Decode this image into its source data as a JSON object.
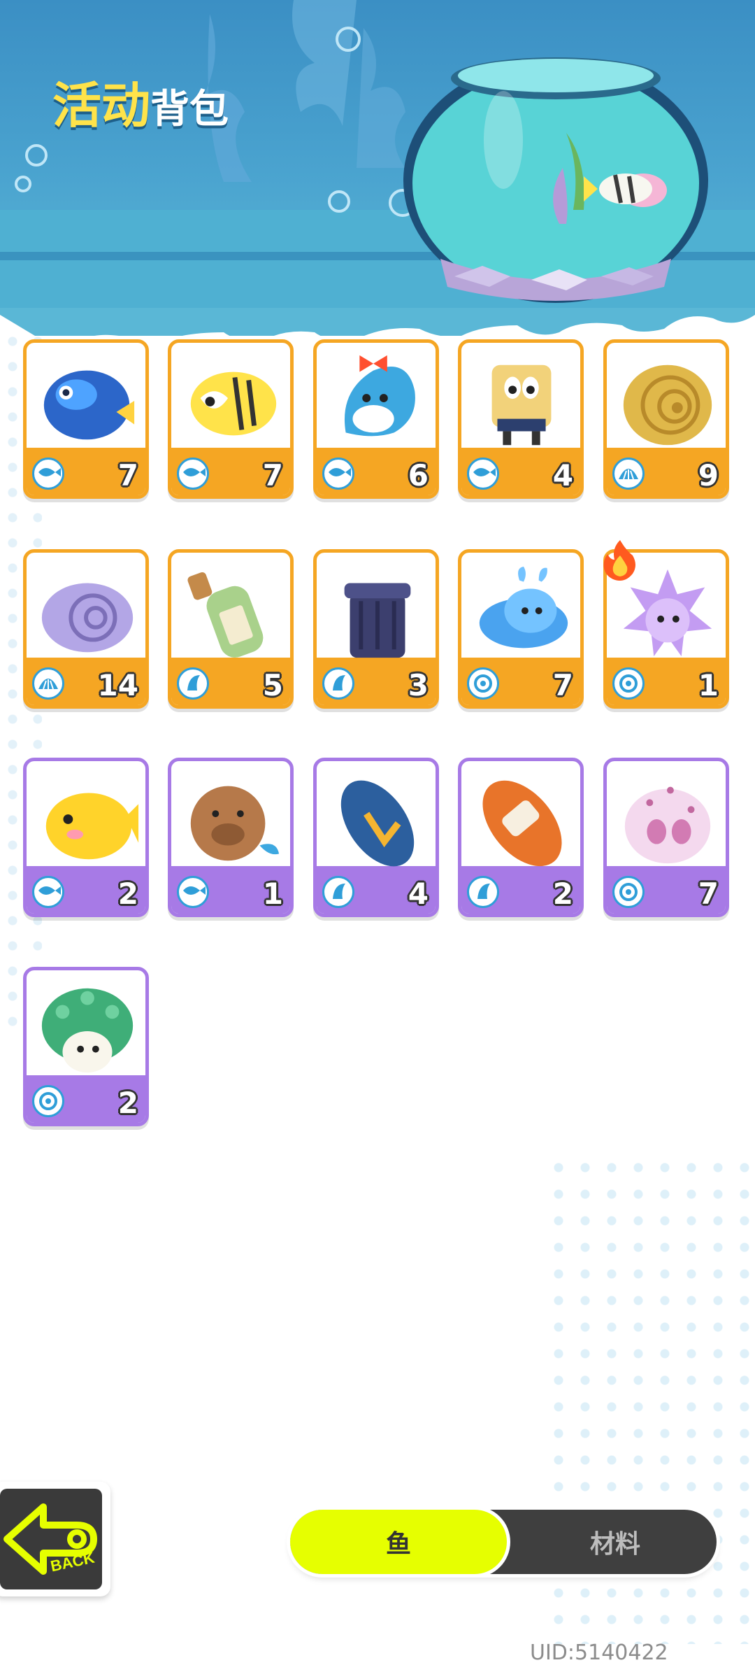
{
  "header": {
    "title_accent": "活动",
    "title_main": "背包"
  },
  "colors": {
    "orange_rarity": "#f5a623",
    "purple_rarity": "#a77ae6",
    "active_tab": "#e6ff00",
    "tab_bar": "#3f3f3f"
  },
  "items": [
    {
      "name": "blue-tang-fish",
      "type_icon": "fish-icon",
      "rarity": "orange",
      "count": "7"
    },
    {
      "name": "butterflyfish",
      "type_icon": "fish-icon",
      "rarity": "orange",
      "count": "7"
    },
    {
      "name": "dolphin-with-bow",
      "type_icon": "fish-icon",
      "rarity": "orange",
      "count": "6"
    },
    {
      "name": "sponge-character",
      "type_icon": "fish-icon",
      "rarity": "orange",
      "count": "4"
    },
    {
      "name": "nautilus-shell",
      "type_icon": "shell-icon",
      "rarity": "orange",
      "count": "9"
    },
    {
      "name": "ammonite-fossil",
      "type_icon": "shell-icon",
      "rarity": "orange",
      "count": "14"
    },
    {
      "name": "message-bottle",
      "type_icon": "junk-icon",
      "rarity": "orange",
      "count": "5"
    },
    {
      "name": "trash-can",
      "type_icon": "junk-icon",
      "rarity": "orange",
      "count": "3"
    },
    {
      "name": "blue-sea-slug",
      "type_icon": "creature-icon",
      "rarity": "orange",
      "count": "7"
    },
    {
      "name": "purple-sea-urchin",
      "type_icon": "creature-icon",
      "rarity": "orange",
      "count": "1"
    },
    {
      "name": "yellow-pufferfish",
      "type_icon": "fish-icon",
      "rarity": "purple",
      "count": "2"
    },
    {
      "name": "capybara-mermaid",
      "type_icon": "fish-icon",
      "rarity": "purple",
      "count": "1"
    },
    {
      "name": "blue-flip-flop",
      "type_icon": "junk-icon",
      "rarity": "purple",
      "count": "4"
    },
    {
      "name": "orange-slipper",
      "type_icon": "junk-icon",
      "rarity": "purple",
      "count": "2"
    },
    {
      "name": "pink-puffer-shell",
      "type_icon": "creature-icon",
      "rarity": "purple",
      "count": "7"
    },
    {
      "name": "peacock-sea-creature",
      "type_icon": "creature-icon",
      "rarity": "purple",
      "count": "2"
    }
  ],
  "tabs": {
    "fish": "鱼",
    "materials": "材料"
  },
  "back_label": "BACK",
  "uid": "UID:5140422"
}
